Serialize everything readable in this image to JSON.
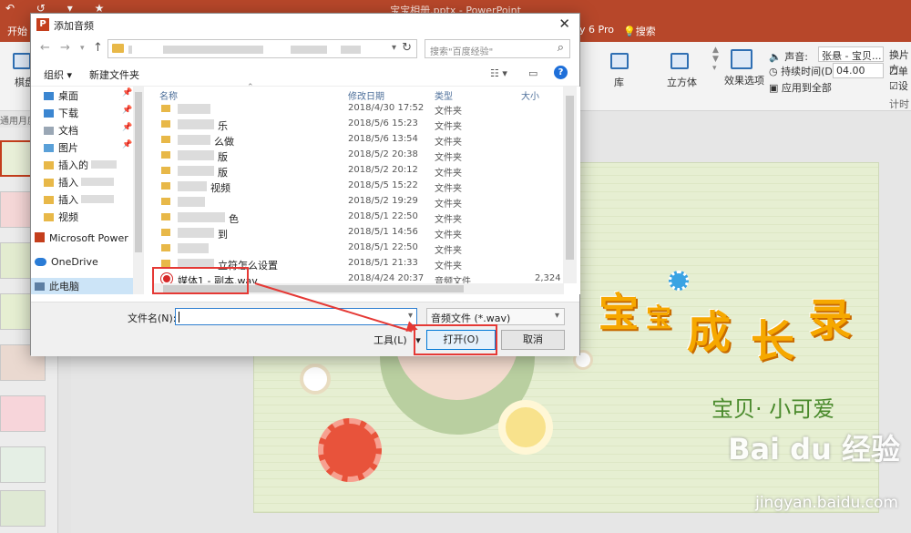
{
  "app": {
    "doc_title": "宝宝相册.pptx - PowerPoint",
    "qat": "↶ ↺ ▾ ★"
  },
  "tabs": {
    "start": "开始",
    "ext": "y 6 Pro",
    "search": "搜索"
  },
  "ribbon": {
    "left_label": "棋盘",
    "gallery_label": "库",
    "cube_label": "立方体",
    "effect_options": "效果选项",
    "sound_label": "声音:",
    "sound_value": "张悬 - 宝贝...",
    "duration_label": "持续时间(D):",
    "duration_value": "04.00",
    "apply_all": "应用到全部",
    "switch_label": "换片方",
    "check1": "单",
    "check2": "设",
    "timing_group": "计时",
    "left_group_label": "通用月度"
  },
  "dialog": {
    "title": "添加音频",
    "search_placeholder": "搜索\"百度经验\"",
    "organize": "组织",
    "new_folder": "新建文件夹",
    "nav_items": [
      {
        "label": "桌面",
        "pinned": true
      },
      {
        "label": "下载",
        "pinned": true
      },
      {
        "label": "文档",
        "pinned": true
      },
      {
        "label": "图片",
        "pinned": true
      },
      {
        "label": "插入的",
        "pinned": false
      },
      {
        "label": "插入",
        "pinned": false
      },
      {
        "label": "插入",
        "pinned": false
      },
      {
        "label": "视频",
        "pinned": false
      },
      {
        "label": "Microsoft Power",
        "pinned": false
      },
      {
        "label": "OneDrive",
        "pinned": false
      },
      {
        "label": "此电脑",
        "pinned": false
      }
    ],
    "columns": {
      "name": "名称",
      "date": "修改日期",
      "type": "类型",
      "size": "大小"
    },
    "rows": [
      {
        "name": "",
        "date": "2018/4/30 17:52",
        "type": "文件夹",
        "size": ""
      },
      {
        "name": "乐",
        "date": "2018/5/6 15:23",
        "type": "文件夹",
        "size": ""
      },
      {
        "name": "么做",
        "date": "2018/5/6 13:54",
        "type": "文件夹",
        "size": ""
      },
      {
        "name": "版",
        "date": "2018/5/2 20:38",
        "type": "文件夹",
        "size": ""
      },
      {
        "name": "版",
        "date": "2018/5/2 20:12",
        "type": "文件夹",
        "size": ""
      },
      {
        "name": "视频",
        "date": "2018/5/5 15:22",
        "type": "文件夹",
        "size": ""
      },
      {
        "name": "",
        "date": "2018/5/2 19:29",
        "type": "文件夹",
        "size": ""
      },
      {
        "name": "色",
        "date": "2018/5/1 22:50",
        "type": "文件夹",
        "size": ""
      },
      {
        "name": "到",
        "date": "2018/5/1 14:56",
        "type": "文件夹",
        "size": ""
      },
      {
        "name": "",
        "date": "2018/5/1 22:50",
        "type": "文件夹",
        "size": ""
      },
      {
        "name": "立符怎么设置",
        "date": "2018/5/1 21:33",
        "type": "文件夹",
        "size": ""
      },
      {
        "name": "媒体1 - 副本.wav",
        "date": "2018/4/24 20:37",
        "type": "音频文件",
        "size": "2,324 K"
      }
    ],
    "filename_label": "文件名(N):",
    "filename_value": "",
    "filetype_value": "音频文件 (*.wav)",
    "tools_label": "工具(L)",
    "open_label": "打开(O)",
    "cancel_label": "取消"
  },
  "slide": {
    "title_chars": [
      "宝",
      "宝",
      "成",
      "长",
      "录"
    ],
    "subtitle": "宝贝· 小可爱",
    "watermark": "Bai du 经验",
    "watermark_url": "jingyan.baidu.com"
  },
  "colors": {
    "accent": "#b7472a",
    "highlight": "#e53935",
    "title": "#f6a800"
  }
}
